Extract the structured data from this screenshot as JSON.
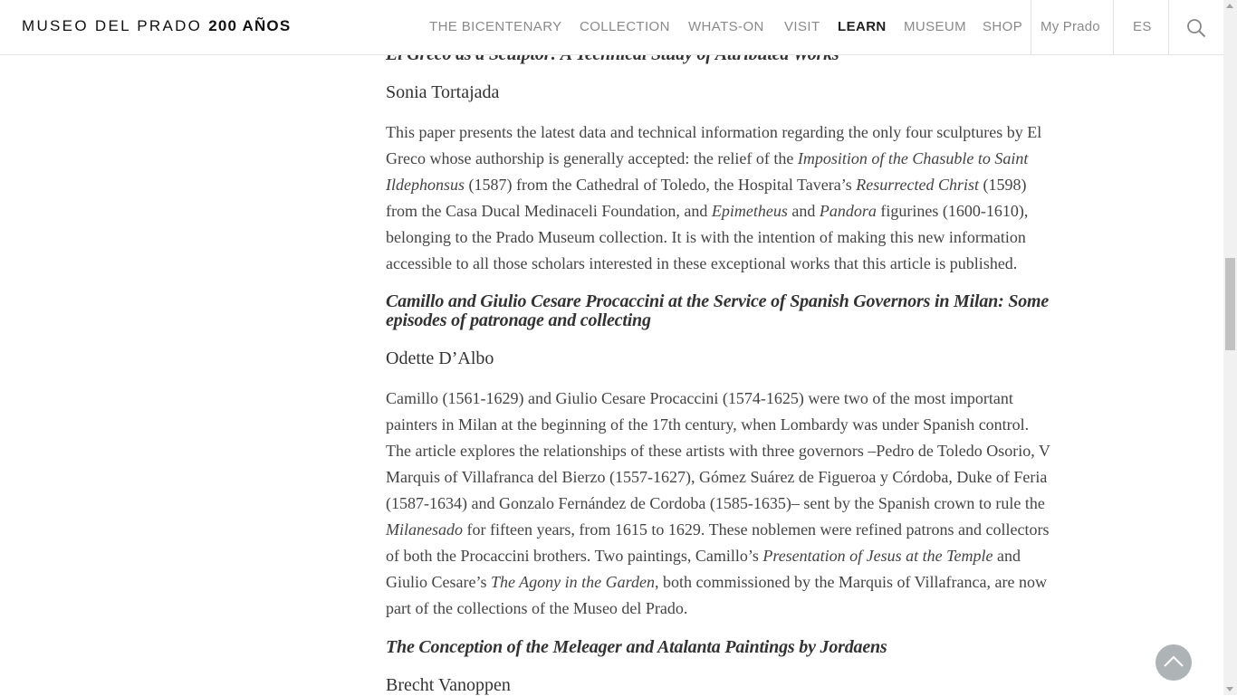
{
  "header": {
    "logo_text": "MUSEO DEL PRADO",
    "logo_bold": "200 AÑOS",
    "nav": [
      "THE BICENTENARY",
      "COLLECTION",
      "WHATS-ON",
      "VISIT",
      "LEARN",
      "MUSEUM",
      "SHOP"
    ],
    "my_prado": "My Prado",
    "language": "ES",
    "search_icon": "search-icon"
  },
  "articles": [
    {
      "title": "El Greco as a Sculptor: A Technical Study of Attributed Works",
      "author": "Sonia Tortajada",
      "abstract": [
        {
          "t": "This paper presents the latest data and technical information regarding the only four sculptures by El Greco whose authorship is generally accepted: the relief of the "
        },
        {
          "i": "Imposition of the Chasuble to Saint Ildephonsus"
        },
        {
          "t": " (1587) from the Cathedral of Toledo, the Hospital Tavera’s "
        },
        {
          "i": "Resurrected Christ"
        },
        {
          "t": " (1598) from the Casa Ducal Medinaceli Foundation, and "
        },
        {
          "i": "Epimetheus"
        },
        {
          "t": " and "
        },
        {
          "i": "Pandora"
        },
        {
          "t": " figurines (1600-1610), belonging to the Prado Museum collection. It is with the intention of making this new information accessible to all those scholars interested in these exceptional works that this article is published."
        }
      ]
    },
    {
      "title": "Camillo and Giulio Cesare Procaccini at the Service of Spanish Governors in Milan: Some episodes of patronage and collecting",
      "author": "Odette D’Albo",
      "abstract": [
        {
          "t": "Camillo (1561-1629) and Giulio Cesare Procaccini (1574-1625) were two of the most important painters in Milan at the beginning of the 17th century, when Lombardy was under Spanish control. The article explores the relationships of these artists with three governors –Pedro de Toledo Osorio, V Marquis of Villafranca del Bierzo (1557-1627), Gómez Suárez de Figueroa y Córdoba, Duke of Feria (1587-1634) and Gonzalo Fernández de Cordoba (1585-1635)– sent by the Spanish crown to rule the "
        },
        {
          "i": "Milanesado"
        },
        {
          "t": " for fifteen years, from 1615 to 1629. These noblemen were refined patrons and collectors of both the Procaccini brothers. Two paintings, Camillo’s "
        },
        {
          "i": "Presentation of Jesus at the Temple"
        },
        {
          "t": " and Giulio Cesare’s "
        },
        {
          "i": "The Agony in the Garden"
        },
        {
          "t": ", both commissioned by the Marquis of Villafranca, are now part of the collections of the Museo del Prado."
        }
      ]
    },
    {
      "title": "The Conception of the Meleager and Atalanta Paintings by Jordaens",
      "author": "Brecht Vanoppen"
    }
  ],
  "back_to_top": "chevron-up-icon"
}
